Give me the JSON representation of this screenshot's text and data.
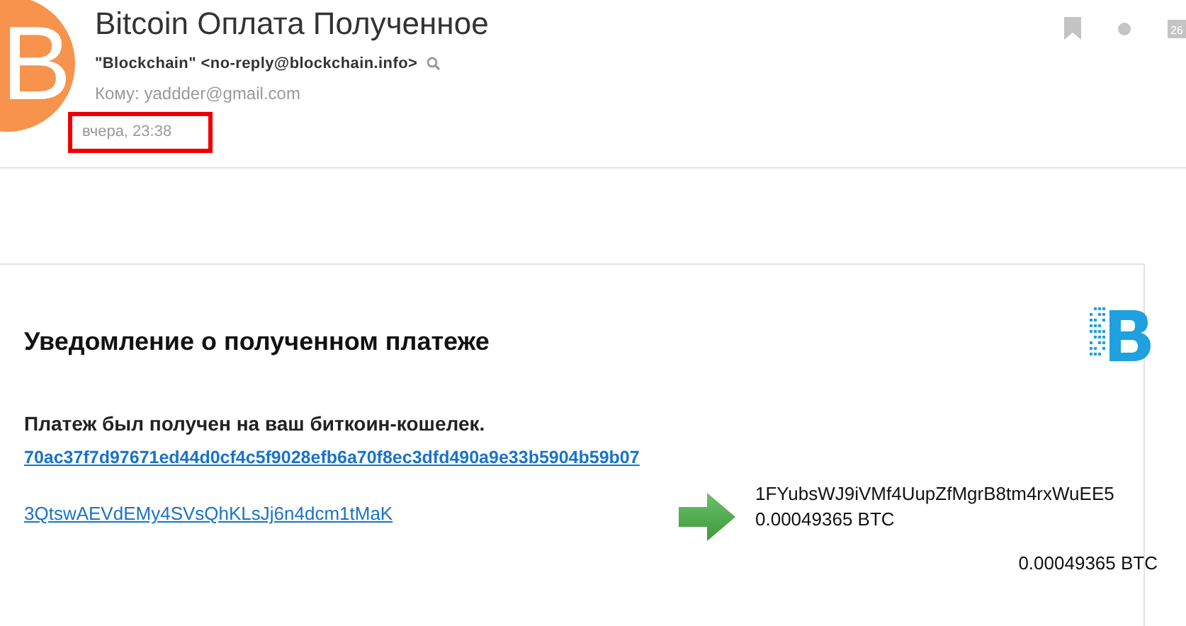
{
  "header": {
    "avatar_letter": "B",
    "subject": "Bitcoin Оплата Полученное",
    "sender": "\"Blockchain\" <no-reply@blockchain.info>",
    "recipient": "Кому: yaddder@gmail.com",
    "date": {
      "text": "вчера, 23:38",
      "highlighted": true
    },
    "calendar_day": "26"
  },
  "notice": {
    "title": "Уведомление о полученном платеже",
    "message": "Платеж был получен на ваш биткоин-кошелек.",
    "tx_hash": "70ac37f7d97671ed44d0cf4c5f9028efb6a70f8ec3dfd490a9e33b5904b59b07",
    "from_address": "3QtswAEVdEMy4SVsQhKLsJj6n4dcm1tMaK",
    "outputs": [
      {
        "address": "1FYubsWJ9iVMf4UupZfMgrB8tm4rxWuEE5",
        "amount": "0.00049365 BTC"
      }
    ],
    "total": "0.00049365 BTC"
  }
}
